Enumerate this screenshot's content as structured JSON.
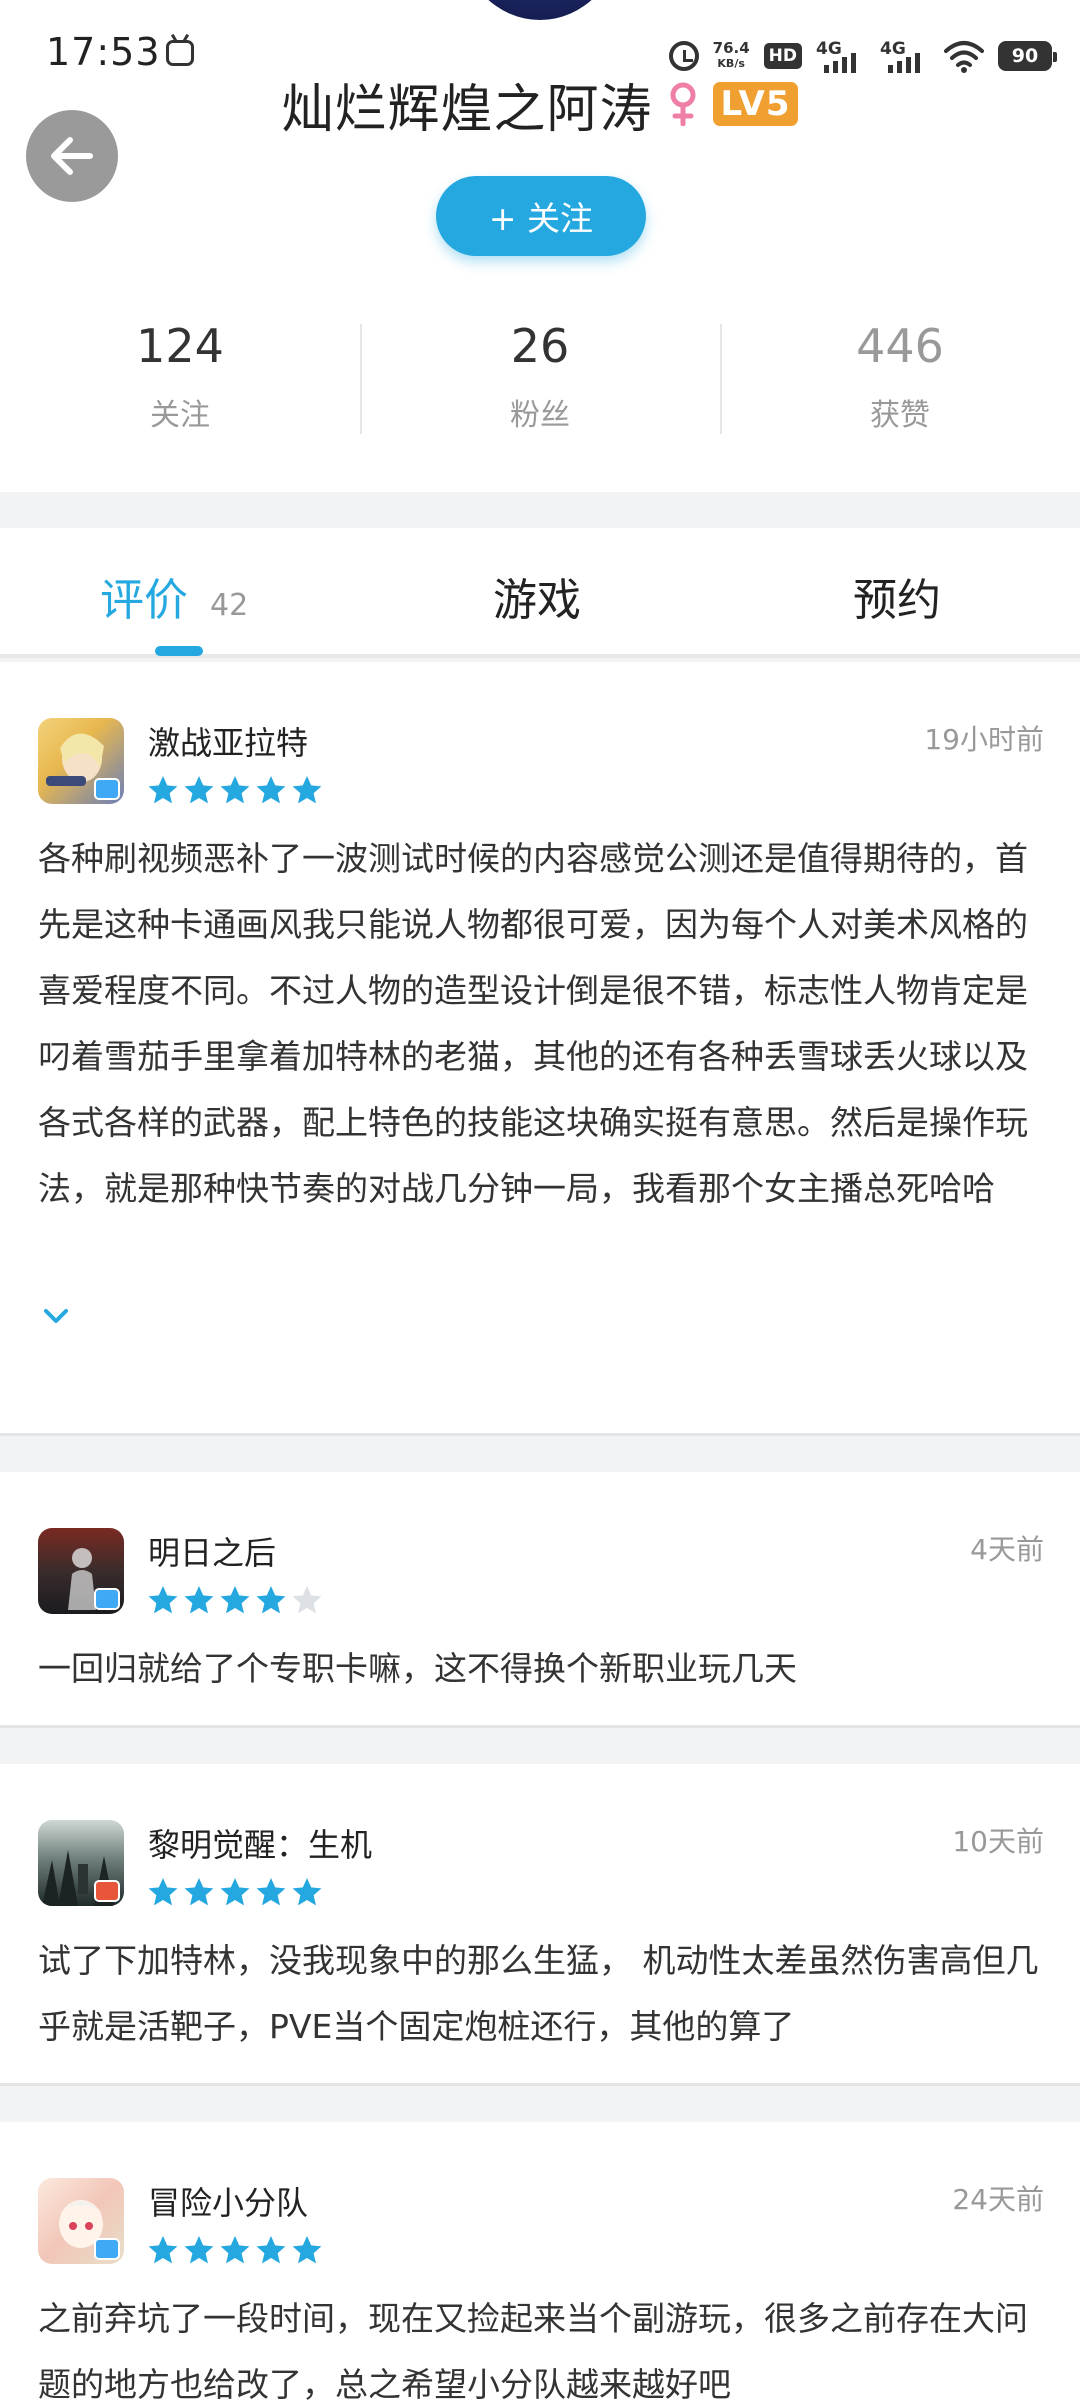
{
  "status_bar": {
    "time": "17:53",
    "net_speed_value": "76.4",
    "net_speed_unit": "KB/s",
    "hd_label": "HD",
    "sim1_label": "4G",
    "sim2_label": "4G",
    "battery": "90"
  },
  "profile": {
    "username": "灿烂辉煌之阿涛",
    "gender": "female",
    "level_badge": "LV5",
    "follow_button": "+ 关注",
    "stats": [
      {
        "value": "124",
        "label": "关注"
      },
      {
        "value": "26",
        "label": "粉丝"
      },
      {
        "value": "446",
        "label": "获赞"
      }
    ]
  },
  "tabs": [
    {
      "label": "评价",
      "count": "42",
      "active": true
    },
    {
      "label": "游戏",
      "active": false
    },
    {
      "label": "预约",
      "active": false
    }
  ],
  "reviews": [
    {
      "game": "激战亚拉特",
      "time": "19小时前",
      "rating": 5,
      "text": "各种刷视频恶补了一波测试时候的内容感觉公测还是值得期待的，首先是这种卡通画风我只能说人物都很可爱，因为每个人对美术风格的喜爱程度不同。不过人物的造型设计倒是很不错，标志性人物肯定是叼着雪茄手里拿着加特林的老猫，其他的还有各种丢雪球丢火球以及各式各样的武器，配上特色的技能这块确实挺有意思。然后是操作玩法，就是那种快节奏的对战几分钟一局，我看那个女主播总死哈哈哈，这个角色血量也太少了吧不过",
      "truncated": true
    },
    {
      "game": "明日之后",
      "time": "4天前",
      "rating": 4,
      "text": "一回归就给了个专职卡嘛，这不得换个新职业玩几天"
    },
    {
      "game": "黎明觉醒：生机",
      "time": "10天前",
      "rating": 5,
      "text": "试了下加特林，没我现象中的那么生猛， 机动性太差虽然伤害高但几乎就是活靶子，PVE当个固定炮桩还行，其他的算了"
    },
    {
      "game": "冒险小分队",
      "time": "24天前",
      "rating": 5,
      "text": "之前弃坑了一段时间，现在又捡起来当个副游玩，很多之前存在大问题的地方也给改了，总之希望小分队越来越好吧"
    }
  ],
  "colors": {
    "accent": "#25a8e0",
    "star_filled": "#25a8e0",
    "star_empty": "#dde1e5",
    "level_badge": "#f0a030",
    "gender_female": "#f07fa8"
  }
}
